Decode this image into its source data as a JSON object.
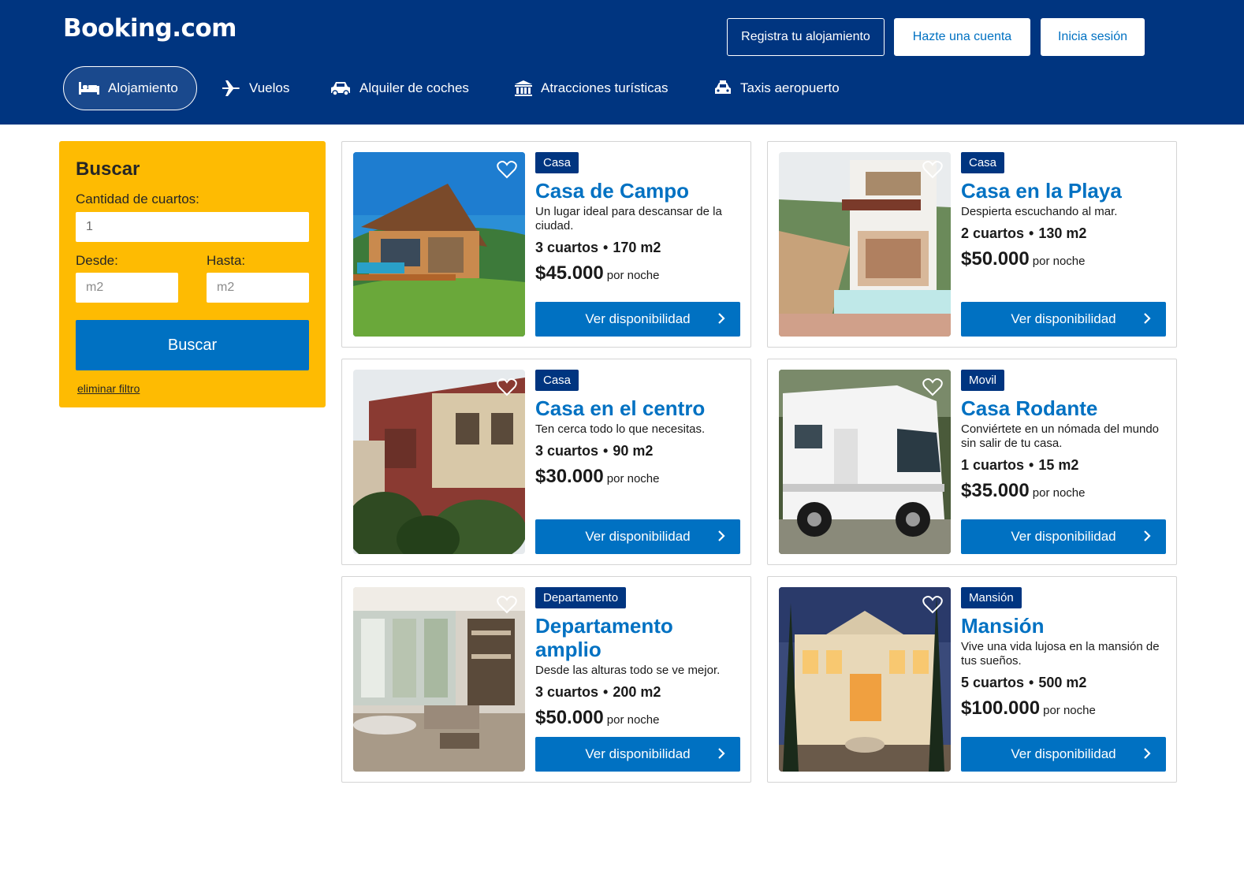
{
  "header": {
    "logo": "Booking.com",
    "register_property": "Registra tu alojamiento",
    "create_account": "Hazte una cuenta",
    "sign_in": "Inicia sesión"
  },
  "nav": {
    "items": [
      {
        "label": "Alojamiento",
        "icon": "bed-icon",
        "active": true
      },
      {
        "label": "Vuelos",
        "icon": "plane-icon",
        "active": false
      },
      {
        "label": "Alquiler de coches",
        "icon": "car-icon",
        "active": false
      },
      {
        "label": "Atracciones turísticas",
        "icon": "attraction-icon",
        "active": false
      },
      {
        "label": "Taxis aeropuerto",
        "icon": "taxi-icon",
        "active": false
      }
    ]
  },
  "search": {
    "title": "Buscar",
    "rooms_label": "Cantidad de cuartos:",
    "rooms_value": "1",
    "from_label": "Desde:",
    "from_placeholder": "m2",
    "to_label": "Hasta:",
    "to_placeholder": "m2",
    "button": "Buscar",
    "clear": "eliminar filtro"
  },
  "listings": [
    {
      "badge": "Casa",
      "title": "Casa de Campo",
      "desc": "Un lugar ideal para descansar de la ciudad.",
      "rooms": "3 cuartos",
      "area": "170 m2",
      "price": "$45.000",
      "per": "por noche",
      "cta": "Ver disponibilidad"
    },
    {
      "badge": "Casa",
      "title": "Casa en la Playa",
      "desc": "Despierta escuchando al mar.",
      "rooms": "2 cuartos",
      "area": "130 m2",
      "price": "$50.000",
      "per": "por noche",
      "cta": "Ver disponibilidad"
    },
    {
      "badge": "Casa",
      "title": "Casa en el centro",
      "desc": "Ten cerca todo lo que necesitas.",
      "rooms": "3 cuartos",
      "area": "90 m2",
      "price": "$30.000",
      "per": "por noche",
      "cta": "Ver disponibilidad"
    },
    {
      "badge": "Movil",
      "title": "Casa Rodante",
      "desc": "Conviértete en un nómada del mundo sin salir de tu casa.",
      "rooms": "1 cuartos",
      "area": "15 m2",
      "price": "$35.000",
      "per": "por noche",
      "cta": "Ver disponibilidad"
    },
    {
      "badge": "Departamento",
      "title": "Departamento amplio",
      "desc": "Desde las alturas todo se ve mejor.",
      "rooms": "3 cuartos",
      "area": "200 m2",
      "price": "$50.000",
      "per": "por noche",
      "cta": "Ver disponibilidad"
    },
    {
      "badge": "Mansión",
      "title": "Mansión",
      "desc": "Vive una vida lujosa en la mansión de tus sueños.",
      "rooms": "5 cuartos",
      "area": "500 m2",
      "price": "$100.000",
      "per": "por noche",
      "cta": "Ver disponibilidad"
    }
  ],
  "colors": {
    "header_bg": "#003580",
    "accent_blue": "#0071c2",
    "search_yellow": "#febb02"
  }
}
